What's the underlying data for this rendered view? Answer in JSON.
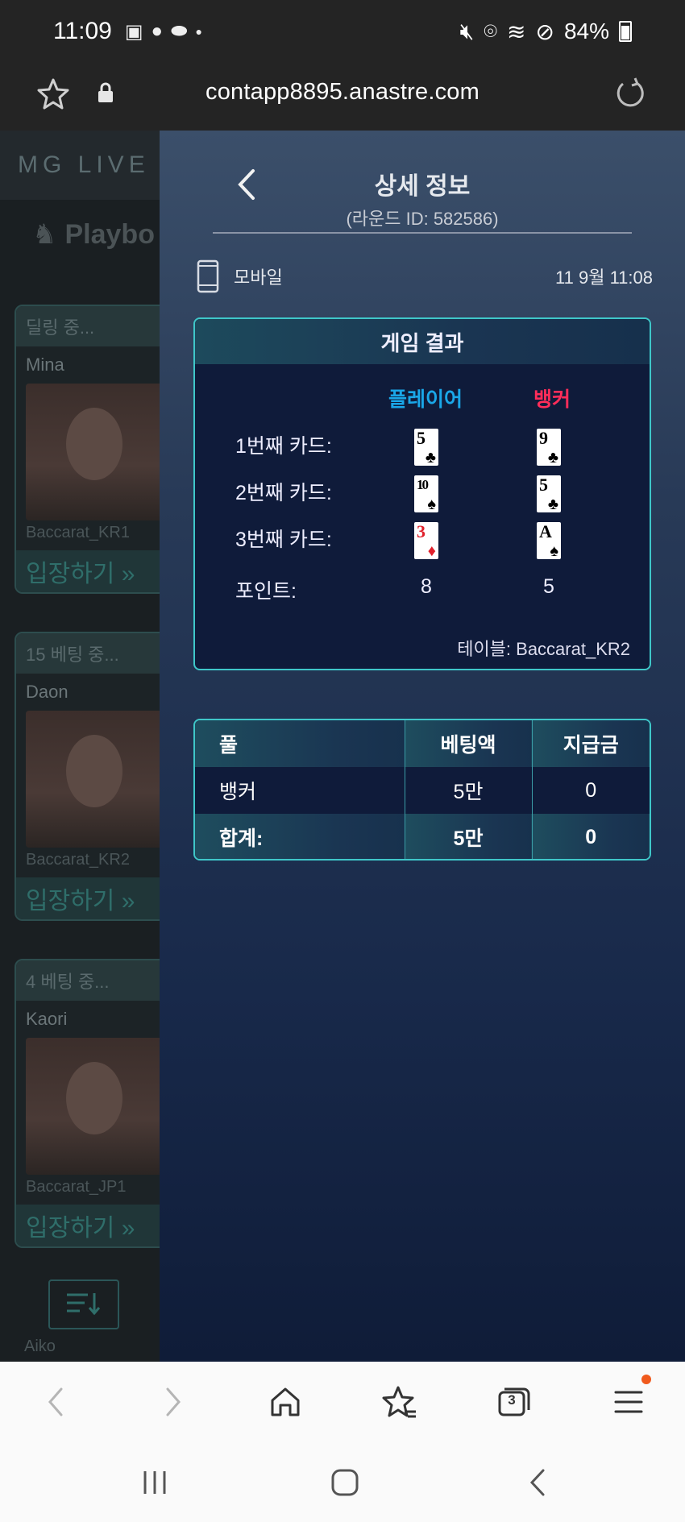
{
  "status_bar": {
    "time": "11:09",
    "battery": "84%",
    "left_icons": [
      "image-icon",
      "talk-icon",
      "pill-icon",
      "dot-icon"
    ],
    "right_icons": [
      "mute-icon",
      "location-icon",
      "wifi-icon",
      "block-icon",
      "battery-icon"
    ]
  },
  "browser": {
    "url": "contapp8895.anastre.com"
  },
  "background_app": {
    "logo": "MG LIVE",
    "tab": "Playbo",
    "cards": [
      {
        "status": "딜링 중...",
        "dealer": "Mina",
        "table": "Baccarat_KR1",
        "enter": "입장하기 »"
      },
      {
        "status": "15  베팅 중...",
        "dealer": "Daon",
        "table": "Baccarat_KR2",
        "enter": "입장하기 »"
      },
      {
        "status": "4  베팅 중...",
        "dealer": "Kaori",
        "table": "Baccarat_JP1",
        "enter": "입장하기 »"
      }
    ],
    "next_dealer": "Aiko"
  },
  "detail": {
    "title": "상세 정보",
    "round_id": "(라운드 ID: 582586)",
    "device": "모바일",
    "datetime": "11  9월 11:08",
    "result": {
      "header": "게임 결과",
      "player_label": "플레이어",
      "banker_label": "뱅커",
      "rows": [
        {
          "label": "1번째 카드:",
          "player": {
            "rank": "5",
            "suit": "♣",
            "color": "#000000"
          },
          "banker": {
            "rank": "9",
            "suit": "♣",
            "color": "#000000"
          }
        },
        {
          "label": "2번째 카드:",
          "player": {
            "rank": "10",
            "suit": "♠",
            "color": "#000000"
          },
          "banker": {
            "rank": "5",
            "suit": "♣",
            "color": "#000000"
          }
        },
        {
          "label": "3번째 카드:",
          "player": {
            "rank": "3",
            "suit": "♦",
            "color": "#e0202b"
          },
          "banker": {
            "rank": "A",
            "suit": "♠",
            "color": "#000000"
          }
        }
      ],
      "points_label": "포인트:",
      "player_points": "8",
      "banker_points": "5",
      "table": "테이블: Baccarat_KR2"
    },
    "bets": {
      "headers": [
        "풀",
        "베팅액",
        "지급금"
      ],
      "rows": [
        [
          "뱅커",
          "5만",
          "0"
        ]
      ],
      "total": [
        "합계:",
        "5만",
        "0"
      ]
    },
    "colors": {
      "player": "#1aa7e8",
      "banker": "#ff2d5a",
      "accent": "#3fc7c9"
    }
  },
  "toolbar": {
    "tabs_count": "3"
  }
}
